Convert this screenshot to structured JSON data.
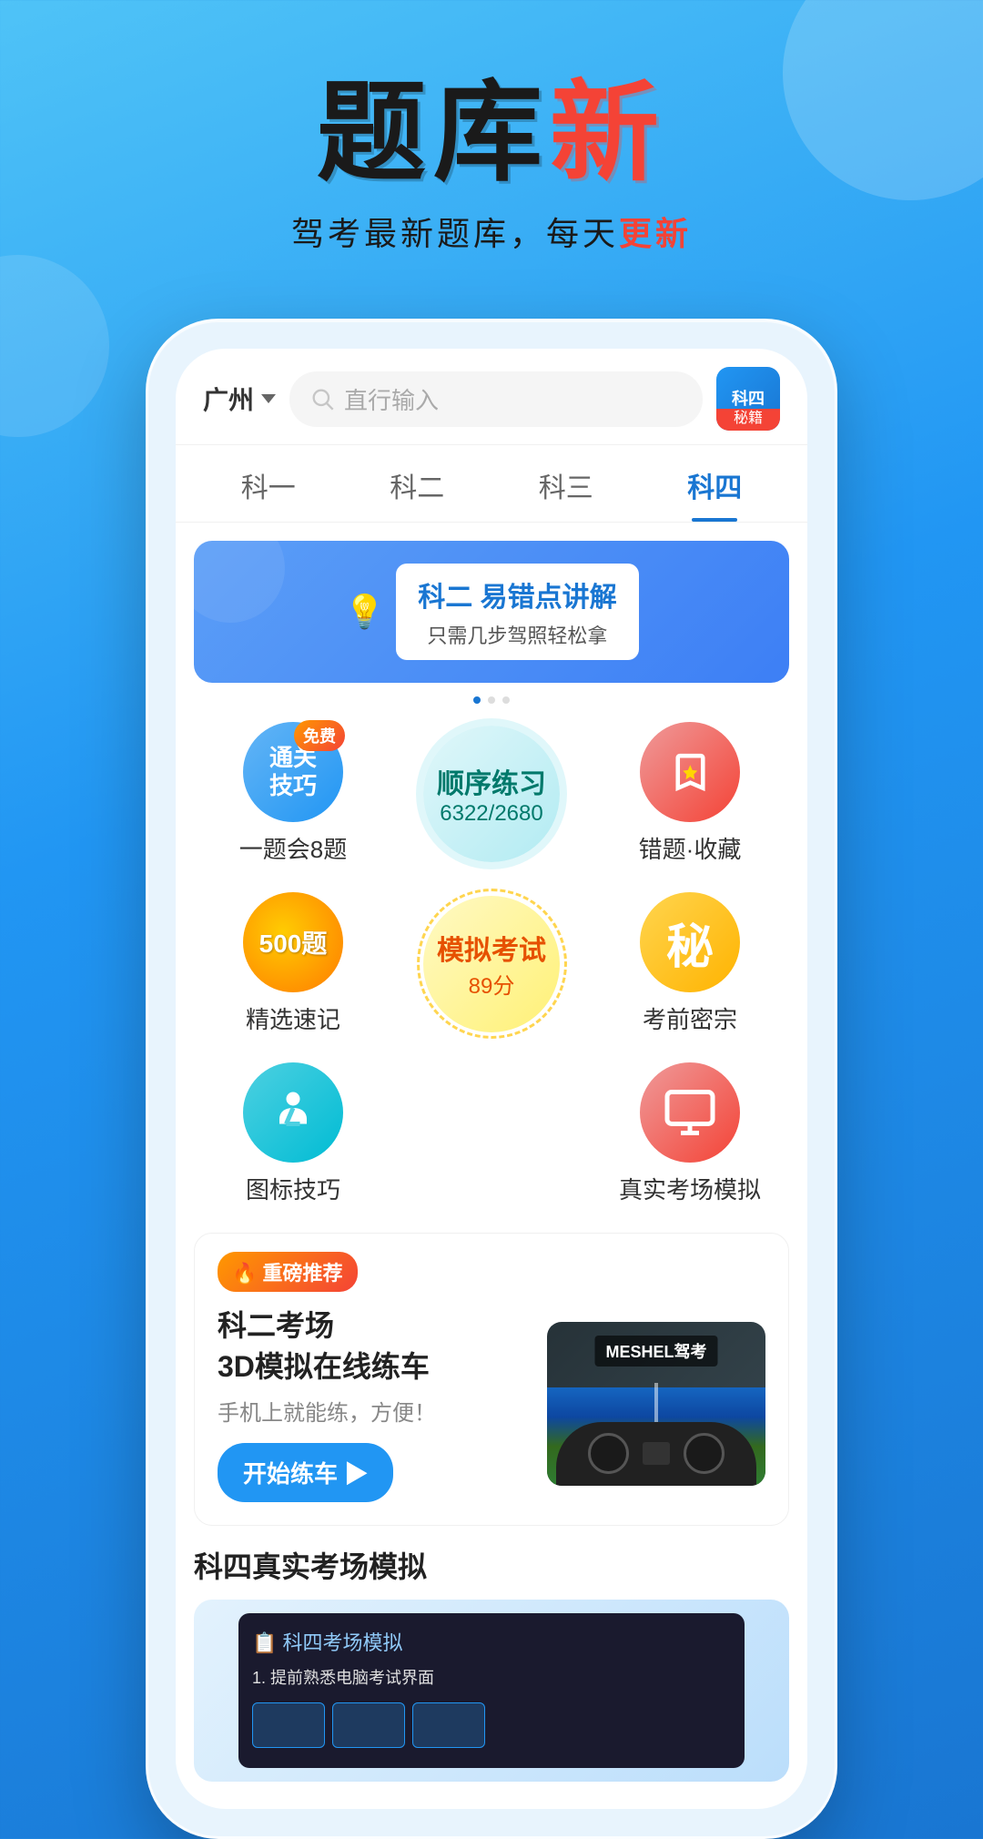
{
  "background": {
    "gradient_start": "#4fc3f7",
    "gradient_end": "#1976d2"
  },
  "header": {
    "title_black": "题库",
    "title_red": "新",
    "subtitle_part1": "驾考最新题库，每天",
    "subtitle_red": "更新"
  },
  "phone": {
    "topbar": {
      "city": "广州",
      "dropdown_arrow": "▼",
      "search_placeholder": "直行输入",
      "secret_badge_top": "科四",
      "secret_badge_bottom": "秘籍"
    },
    "nav_tabs": [
      {
        "label": "科一",
        "active": false
      },
      {
        "label": "科二",
        "active": false
      },
      {
        "label": "科三",
        "active": false
      },
      {
        "label": "科四",
        "active": true
      }
    ],
    "banner": {
      "main_title": "科二 易错点讲解",
      "sub_title": "只需几步驾照轻松拿",
      "icon": "💡"
    },
    "features": {
      "row1": [
        {
          "id": "tricks",
          "label": "一题会8题",
          "icon_text": "通关\n技巧",
          "badge": "免费",
          "type": "circle"
        },
        {
          "id": "practice",
          "label": "顺序练习",
          "count": "6322/2680",
          "type": "large_circle"
        },
        {
          "id": "mistakes",
          "label": "错题·收藏",
          "icon": "bookmark",
          "type": "circle"
        }
      ],
      "row2": [
        {
          "id": "speed",
          "label": "精选速记",
          "icon_text": "500题",
          "type": "circle"
        },
        {
          "id": "mock",
          "label": "模拟考试",
          "score": "89分",
          "type": "large_circle"
        },
        {
          "id": "secret",
          "label": "考前密宗",
          "icon_text": "秘",
          "type": "circle"
        }
      ],
      "row3": [
        {
          "id": "symbol",
          "label": "图标技巧",
          "icon": "person",
          "type": "circle"
        },
        {
          "id": "real",
          "label": "真实考场模拟",
          "icon": "monitor",
          "type": "circle"
        }
      ]
    },
    "recommendation": {
      "badge": "🔥 重磅推荐",
      "title_line1": "科二考场",
      "title_line2": "3D模拟在线练车",
      "description": "手机上就能练，方便！",
      "button_text": "开始练车 ▶",
      "image_label": "MESHEL驾考"
    },
    "sci4_section": {
      "title": "科四真实考场模拟",
      "list_item": "1. 提前熟悉电脑考试界面"
    }
  }
}
